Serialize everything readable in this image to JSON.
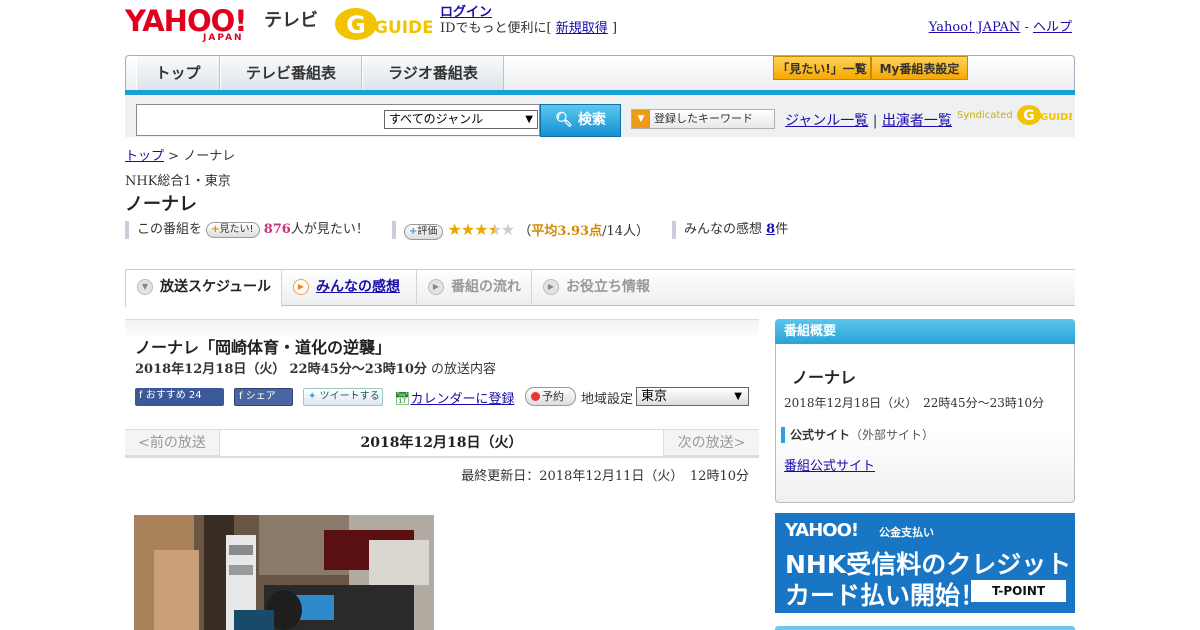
{
  "header": {
    "yahoo_logo": "YAHOO!",
    "yahoo_sub": "JAPAN",
    "tv_label": "テレビ",
    "gguide_logo": "G-GUIDE",
    "login_label": "ログイン",
    "login_prefix": "IDでもっと便利に[",
    "signup_label": "新規取得",
    "login_suffix": "]",
    "yahoo_japan_link": "Yahoo! JAPAN",
    "separator": " - ",
    "help_link": "ヘルプ"
  },
  "nav": {
    "tabs": [
      {
        "label": "トップ"
      },
      {
        "label": "テレビ番組表"
      },
      {
        "label": "ラジオ番組表"
      }
    ],
    "want_list_label": "「見たい!」一覧",
    "my_schedule_label": "My番組表設定"
  },
  "search": {
    "query": "",
    "genre_selected": "すべてのジャンル",
    "search_button": "検索",
    "keyword_button": "登録したキーワード",
    "genre_list_link": "ジャンル一覧",
    "link_separator": "|",
    "cast_list_link": "出演者一覧",
    "syndicated_label": "Syndicated"
  },
  "breadcrumb": {
    "top_link": "トップ",
    "separator": ">",
    "current": "ノーナレ"
  },
  "program": {
    "channel": "NHK総合1・東京",
    "title": "ノーナレ",
    "want_prefix": "この番組を",
    "want_button": "見たい!",
    "want_count": "876",
    "want_suffix": "人が見たい！",
    "rating_button": "評価",
    "rating_value": 3.93,
    "rating_open": "（",
    "rating_avg": "平均3.93点",
    "rating_count": "/14人）",
    "impressions_label": "みんなの感想",
    "impressions_count": "8",
    "impressions_suffix": "件"
  },
  "subtabs": [
    {
      "label": "放送スケジュール"
    },
    {
      "label": "みんなの感想"
    },
    {
      "label": "番組の流れ"
    },
    {
      "label": "お役立ち情報"
    }
  ],
  "episode": {
    "title": "ノーナレ「岡崎体育・道化の逆襲」",
    "date": "2018年12月18日（火）",
    "time": "22時45分～23時10分",
    "date_suffix": "の放送内容",
    "fb_recommend": "おすすめ",
    "fb_count": "24",
    "fb_share": "シェア",
    "tweet": "ツイートする",
    "calendar_link": "カレンダーに登録",
    "reserve_button": "予約",
    "region_label": "地域設定",
    "region_selected": "東京",
    "pager_prev": "<前の放送",
    "pager_current": "2018年12月18日（火）",
    "pager_next": "次の放送>",
    "last_updated": "最終更新日：2018年12月11日（火）　12時10分"
  },
  "sidebar": {
    "header": "番組概要",
    "title": "ノーナレ",
    "date": "2018年12月18日（火）　22時45分～23時10分",
    "official_label": "公式サイト",
    "official_note": "（外部サイト）",
    "official_link": "番組公式サイト"
  },
  "banner": {
    "logo": "YAHOO!",
    "sub": "公金支払い",
    "line1": "NHK受信料のクレジット",
    "line2": "カード払い開始！",
    "tpoint": "T-POINT"
  },
  "colors": {
    "accent_blue": "#1aa0d8",
    "yahoo_red": "#e0001e",
    "star": "#e8a900",
    "pink": "#cc3377"
  }
}
